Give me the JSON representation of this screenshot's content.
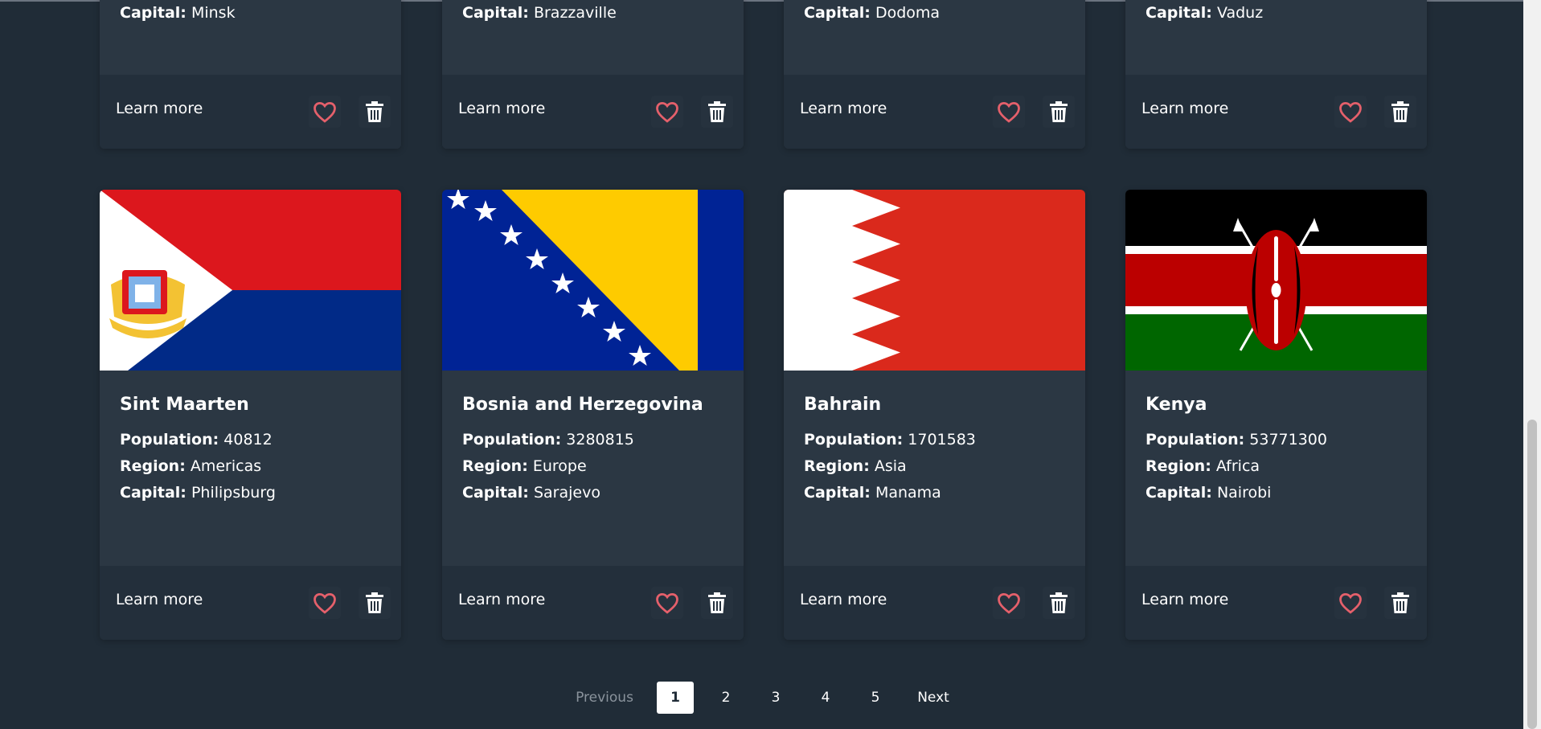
{
  "top_cards": [
    {
      "capital_label": "Capital:",
      "capital": "Minsk"
    },
    {
      "capital_label": "Capital:",
      "capital": "Brazzaville"
    },
    {
      "capital_label": "Capital:",
      "capital": "Dodoma"
    },
    {
      "capital_label": "Capital:",
      "capital": "Vaduz"
    }
  ],
  "cards": [
    {
      "name": "Sint Maarten",
      "population_label": "Population:",
      "population": "40812",
      "region_label": "Region:",
      "region": "Americas",
      "capital_label": "Capital:",
      "capital": "Philipsburg",
      "flag": "sint-maarten-flag"
    },
    {
      "name": "Bosnia and Herzegovina",
      "population_label": "Population:",
      "population": "3280815",
      "region_label": "Region:",
      "region": "Europe",
      "capital_label": "Capital:",
      "capital": "Sarajevo",
      "flag": "bosnia-flag"
    },
    {
      "name": "Bahrain",
      "population_label": "Population:",
      "population": "1701583",
      "region_label": "Region:",
      "region": "Asia",
      "capital_label": "Capital:",
      "capital": "Manama",
      "flag": "bahrain-flag"
    },
    {
      "name": "Kenya",
      "population_label": "Population:",
      "population": "53771300",
      "region_label": "Region:",
      "region": "Africa",
      "capital_label": "Capital:",
      "capital": "Nairobi",
      "flag": "kenya-flag"
    }
  ],
  "footer": {
    "learn_more": "Learn more",
    "heart_icon": "heart-icon",
    "trash_icon": "trash-icon"
  },
  "pagination": {
    "previous": "Previous",
    "pages": [
      "1",
      "2",
      "3",
      "4",
      "5"
    ],
    "next": "Next",
    "current": "1"
  },
  "colors": {
    "background": "#202c37",
    "card": "#2b3743",
    "footer": "#232f3b",
    "heart": "#e5606b"
  }
}
